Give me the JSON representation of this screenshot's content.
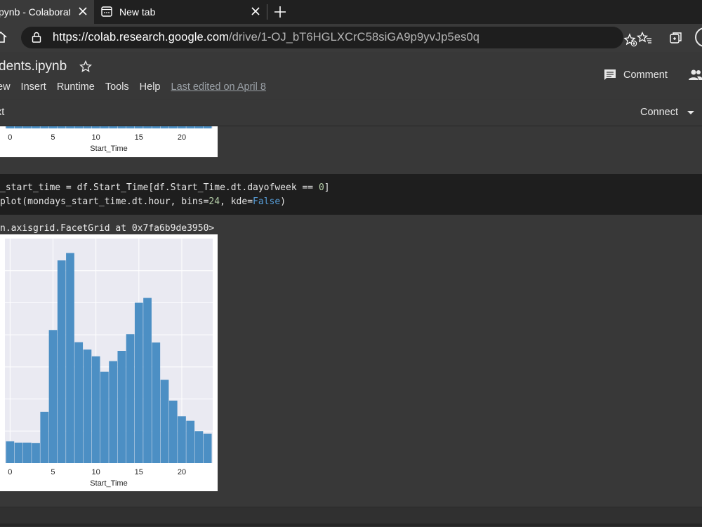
{
  "browser": {
    "tabs": [
      {
        "title": "pynb - Colaboratory"
      },
      {
        "title": "New tab"
      }
    ],
    "url_host": "https://colab.research.google.com",
    "url_path": "/drive/1-OJ_bT6HGLXCrC58siGA9p9yvJp5es0q"
  },
  "colab": {
    "notebook_title": "dents.ipynb",
    "menu": [
      "ew",
      "Insert",
      "Runtime",
      "Tools",
      "Help"
    ],
    "last_edited": "Last edited on April 8",
    "comment_label": "Comment",
    "toolbar_text": "xt",
    "connect_label": "Connect"
  },
  "cell": {
    "line1": {
      "prefix": "_start_time = df.Start_Time[df.Start_Time.dt.dayofweek == ",
      "num": "0",
      "suffix": "]"
    },
    "line2": {
      "prefix": "plot(mondays_start_time.dt.hour, bins=",
      "num": "24",
      "mid": ", kde=",
      "kw": "False",
      "suffix": ")"
    },
    "output_repr": "n.axisgrid.FacetGrid at 0x7fa6b9de3950>"
  },
  "colors": {
    "bar": "#4c8fc4",
    "plot_bg": "#eaeaf2"
  },
  "chart_data": [
    {
      "type": "bar",
      "xlabel": "Start_Time",
      "xticks": [
        0,
        5,
        10,
        15,
        20
      ],
      "x_range": [
        -0.6,
        23.6
      ]
    },
    {
      "type": "bar",
      "xlabel": "Start_Time",
      "xticks": [
        0,
        5,
        10,
        15,
        20
      ],
      "x_range": [
        -0.6,
        23.6
      ],
      "categories": [
        0,
        1,
        2,
        3,
        4,
        5,
        6,
        7,
        8,
        9,
        10,
        11,
        12,
        13,
        14,
        15,
        16,
        17,
        18,
        19,
        20,
        21,
        22,
        23
      ],
      "values": [
        68,
        64,
        64,
        63,
        160,
        415,
        632,
        655,
        377,
        354,
        333,
        285,
        318,
        350,
        402,
        500,
        515,
        376,
        260,
        195,
        146,
        132,
        100,
        92
      ],
      "ylim": [
        0,
        700
      ]
    }
  ]
}
